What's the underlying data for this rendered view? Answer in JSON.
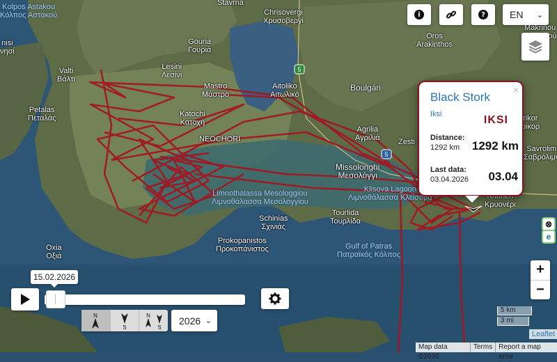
{
  "toolbar": {
    "info_icon": "info-icon",
    "link_icon": "link-icon",
    "help_icon": "question-icon",
    "language": "EN"
  },
  "popup": {
    "title": "Black Stork",
    "close": "×",
    "subtitle": "Iksi",
    "code": "IKSI",
    "distance_label": "Distance:",
    "distance_small": "1292 km",
    "distance_big": "1292 km",
    "last_data_label": "Last data:",
    "last_data_small": "03.04.2026",
    "last_data_big": "03.04"
  },
  "timeline": {
    "date_tooltip": "15.02.2026",
    "position": 0.0,
    "year": "2026",
    "direction_buttons": [
      {
        "name": "north",
        "label_top": "N",
        "label_bottom": ""
      },
      {
        "name": "south",
        "label_top": "",
        "label_bottom": "S"
      },
      {
        "name": "both",
        "label_top": "N",
        "label_bottom": "S"
      }
    ]
  },
  "map": {
    "places": [
      {
        "text": "Kolpos Astakou\nΚόλπος Αστακού",
        "cls": "water"
      },
      {
        "text": "Stavrna",
        "cls": ""
      },
      {
        "text": "Chrisovergi\nΧρυσοβεργί",
        "cls": ""
      },
      {
        "text": "Gouria\nΓουριά",
        "cls": ""
      },
      {
        "text": "Lesini\nΛεσίνι",
        "cls": ""
      },
      {
        "text": "Mastro\nΜάστρο",
        "cls": ""
      },
      {
        "text": "Aitoliko\nΑιτωλικό",
        "cls": ""
      },
      {
        "text": "Boulgári",
        "cls": "big"
      },
      {
        "text": "Oros\nArakinthos",
        "cls": ""
      },
      {
        "text": "Makrinou\nΜακρινού",
        "cls": ""
      },
      {
        "text": "Valti\nΒάλτι",
        "cls": ""
      },
      {
        "text": "Petalas\nΠεταλάς",
        "cls": ""
      },
      {
        "text": "Katochi\nΚατοχή",
        "cls": ""
      },
      {
        "text": "NEOCHORI",
        "cls": ""
      },
      {
        "text": "Agrilia\nΑγριλιά",
        "cls": ""
      },
      {
        "text": "Zesti",
        "cls": ""
      },
      {
        "text": "Missolonghi\nΜεσολόγγι",
        "cls": "big"
      },
      {
        "text": "Trikor\nΤρίκορ",
        "cls": ""
      },
      {
        "text": "Savrolimn\nΣαβρόλιμνη",
        "cls": ""
      },
      {
        "text": "Limnothalassa Mesologgiou\nΛιμνοθάλασσα Μεσολογγίου",
        "cls": "water"
      },
      {
        "text": "Klisova Lagoon\nΛιμνοθάλασσα Κλείσοβα",
        "cls": "water"
      },
      {
        "text": "Krioneri\nΚρυονέρι",
        "cls": ""
      },
      {
        "text": "Schinias\nΣχινιάς",
        "cls": ""
      },
      {
        "text": "Tourlida\nΤουρλίδα",
        "cls": ""
      },
      {
        "text": "Oxia\nΟξιά",
        "cls": ""
      },
      {
        "text": "Prokopanistos\nΠροκοπάνιστος",
        "cls": ""
      },
      {
        "text": "Gulf of Patras\nΠατραϊκός Κόλπος",
        "cls": "water"
      },
      {
        "text": "nisi\nνησί",
        "cls": ""
      }
    ],
    "road_shields": [
      "5",
      "5"
    ],
    "track_color": "#a3161e",
    "zoom_in": "+",
    "zoom_out": "−",
    "side_buttons": [
      "⊗",
      "e"
    ],
    "scale_km": "5 km",
    "scale_mi": "3 mi",
    "leaflet": "Leaflet",
    "attribution": [
      "Map data ©2026",
      "Terms",
      "Report a map error"
    ]
  }
}
